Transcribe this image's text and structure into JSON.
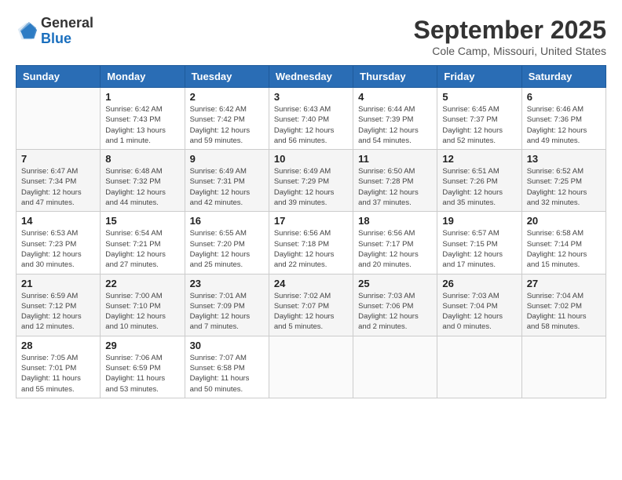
{
  "header": {
    "logo_general": "General",
    "logo_blue": "Blue",
    "month_year": "September 2025",
    "location": "Cole Camp, Missouri, United States"
  },
  "weekdays": [
    "Sunday",
    "Monday",
    "Tuesday",
    "Wednesday",
    "Thursday",
    "Friday",
    "Saturday"
  ],
  "weeks": [
    [
      {
        "day": "",
        "info": ""
      },
      {
        "day": "1",
        "info": "Sunrise: 6:42 AM\nSunset: 7:43 PM\nDaylight: 13 hours\nand 1 minute."
      },
      {
        "day": "2",
        "info": "Sunrise: 6:42 AM\nSunset: 7:42 PM\nDaylight: 12 hours\nand 59 minutes."
      },
      {
        "day": "3",
        "info": "Sunrise: 6:43 AM\nSunset: 7:40 PM\nDaylight: 12 hours\nand 56 minutes."
      },
      {
        "day": "4",
        "info": "Sunrise: 6:44 AM\nSunset: 7:39 PM\nDaylight: 12 hours\nand 54 minutes."
      },
      {
        "day": "5",
        "info": "Sunrise: 6:45 AM\nSunset: 7:37 PM\nDaylight: 12 hours\nand 52 minutes."
      },
      {
        "day": "6",
        "info": "Sunrise: 6:46 AM\nSunset: 7:36 PM\nDaylight: 12 hours\nand 49 minutes."
      }
    ],
    [
      {
        "day": "7",
        "info": "Sunrise: 6:47 AM\nSunset: 7:34 PM\nDaylight: 12 hours\nand 47 minutes."
      },
      {
        "day": "8",
        "info": "Sunrise: 6:48 AM\nSunset: 7:32 PM\nDaylight: 12 hours\nand 44 minutes."
      },
      {
        "day": "9",
        "info": "Sunrise: 6:49 AM\nSunset: 7:31 PM\nDaylight: 12 hours\nand 42 minutes."
      },
      {
        "day": "10",
        "info": "Sunrise: 6:49 AM\nSunset: 7:29 PM\nDaylight: 12 hours\nand 39 minutes."
      },
      {
        "day": "11",
        "info": "Sunrise: 6:50 AM\nSunset: 7:28 PM\nDaylight: 12 hours\nand 37 minutes."
      },
      {
        "day": "12",
        "info": "Sunrise: 6:51 AM\nSunset: 7:26 PM\nDaylight: 12 hours\nand 35 minutes."
      },
      {
        "day": "13",
        "info": "Sunrise: 6:52 AM\nSunset: 7:25 PM\nDaylight: 12 hours\nand 32 minutes."
      }
    ],
    [
      {
        "day": "14",
        "info": "Sunrise: 6:53 AM\nSunset: 7:23 PM\nDaylight: 12 hours\nand 30 minutes."
      },
      {
        "day": "15",
        "info": "Sunrise: 6:54 AM\nSunset: 7:21 PM\nDaylight: 12 hours\nand 27 minutes."
      },
      {
        "day": "16",
        "info": "Sunrise: 6:55 AM\nSunset: 7:20 PM\nDaylight: 12 hours\nand 25 minutes."
      },
      {
        "day": "17",
        "info": "Sunrise: 6:56 AM\nSunset: 7:18 PM\nDaylight: 12 hours\nand 22 minutes."
      },
      {
        "day": "18",
        "info": "Sunrise: 6:56 AM\nSunset: 7:17 PM\nDaylight: 12 hours\nand 20 minutes."
      },
      {
        "day": "19",
        "info": "Sunrise: 6:57 AM\nSunset: 7:15 PM\nDaylight: 12 hours\nand 17 minutes."
      },
      {
        "day": "20",
        "info": "Sunrise: 6:58 AM\nSunset: 7:14 PM\nDaylight: 12 hours\nand 15 minutes."
      }
    ],
    [
      {
        "day": "21",
        "info": "Sunrise: 6:59 AM\nSunset: 7:12 PM\nDaylight: 12 hours\nand 12 minutes."
      },
      {
        "day": "22",
        "info": "Sunrise: 7:00 AM\nSunset: 7:10 PM\nDaylight: 12 hours\nand 10 minutes."
      },
      {
        "day": "23",
        "info": "Sunrise: 7:01 AM\nSunset: 7:09 PM\nDaylight: 12 hours\nand 7 minutes."
      },
      {
        "day": "24",
        "info": "Sunrise: 7:02 AM\nSunset: 7:07 PM\nDaylight: 12 hours\nand 5 minutes."
      },
      {
        "day": "25",
        "info": "Sunrise: 7:03 AM\nSunset: 7:06 PM\nDaylight: 12 hours\nand 2 minutes."
      },
      {
        "day": "26",
        "info": "Sunrise: 7:03 AM\nSunset: 7:04 PM\nDaylight: 12 hours\nand 0 minutes."
      },
      {
        "day": "27",
        "info": "Sunrise: 7:04 AM\nSunset: 7:02 PM\nDaylight: 11 hours\nand 58 minutes."
      }
    ],
    [
      {
        "day": "28",
        "info": "Sunrise: 7:05 AM\nSunset: 7:01 PM\nDaylight: 11 hours\nand 55 minutes."
      },
      {
        "day": "29",
        "info": "Sunrise: 7:06 AM\nSunset: 6:59 PM\nDaylight: 11 hours\nand 53 minutes."
      },
      {
        "day": "30",
        "info": "Sunrise: 7:07 AM\nSunset: 6:58 PM\nDaylight: 11 hours\nand 50 minutes."
      },
      {
        "day": "",
        "info": ""
      },
      {
        "day": "",
        "info": ""
      },
      {
        "day": "",
        "info": ""
      },
      {
        "day": "",
        "info": ""
      }
    ]
  ]
}
